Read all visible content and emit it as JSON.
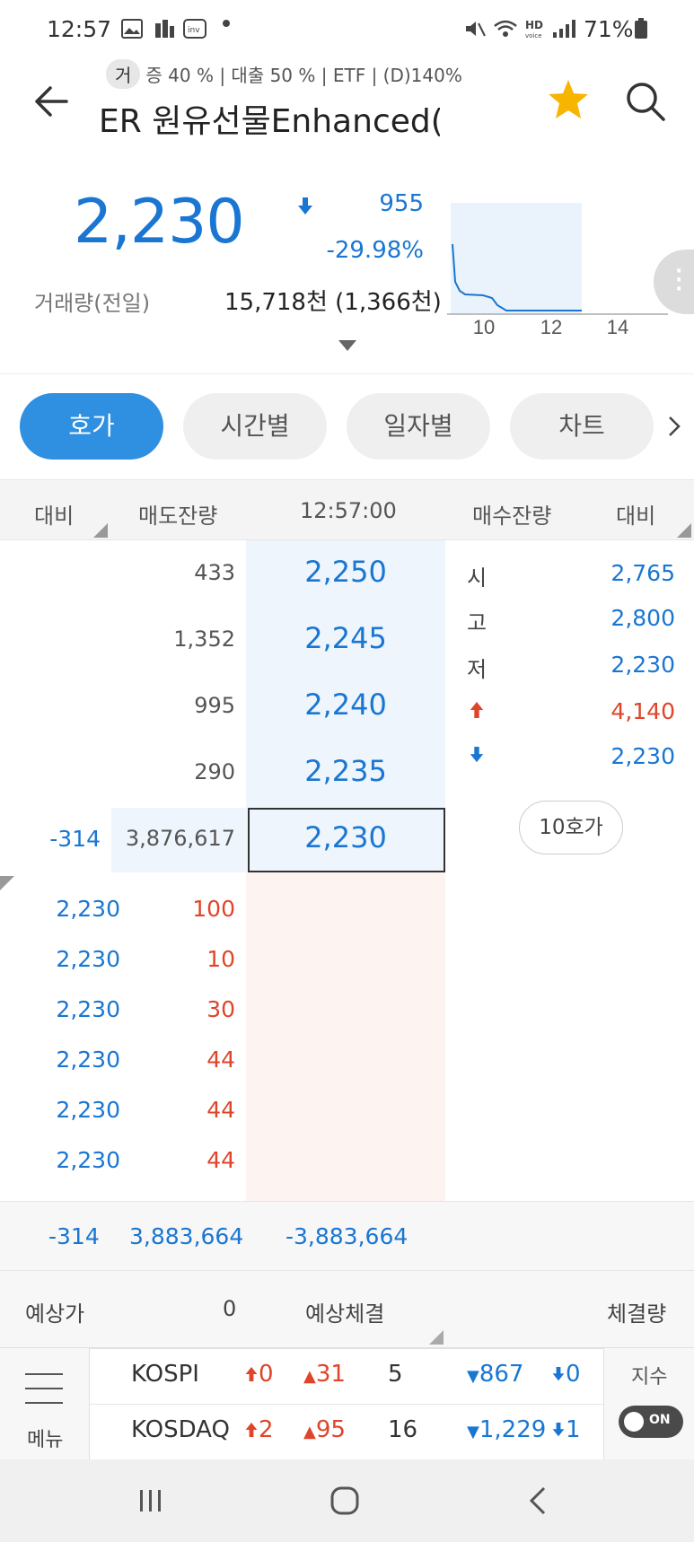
{
  "status_bar": {
    "time": "12:57",
    "battery": "71%"
  },
  "header": {
    "tag_chip": "거",
    "tagline": "증 40 % | 대출 50 % | ETF | (D)140%",
    "title": "ER 원유선물Enhanced("
  },
  "quote": {
    "price": "2,230",
    "change": "955",
    "change_pct": "-29.98%",
    "volume_label": "거래량(전일)",
    "volume_value": "15,718천 (1,366천)",
    "mini_chart_ticks": [
      "10",
      "12",
      "14"
    ]
  },
  "tabs": [
    "호가",
    "시간별",
    "일자별",
    "차트"
  ],
  "orderbook": {
    "headers": {
      "left_diff": "대비",
      "ask_qty": "매도잔량",
      "time": "12:57:00",
      "bid_qty": "매수잔량",
      "right_diff": "대비"
    },
    "asks": [
      {
        "qty": "433",
        "price": "2,250"
      },
      {
        "qty": "1,352",
        "price": "2,245"
      },
      {
        "qty": "995",
        "price": "2,240"
      },
      {
        "qty": "290",
        "price": "2,235"
      }
    ],
    "current": {
      "diff": "-314",
      "qty": "3,876,617",
      "price": "2,230"
    },
    "info": [
      {
        "label": "시",
        "value": "2,765"
      },
      {
        "label": "고",
        "value": "2,800"
      },
      {
        "label": "저",
        "value": "2,230"
      },
      {
        "label": "▲",
        "value": "4,140"
      },
      {
        "label": "▼",
        "value": "2,230"
      }
    ],
    "ten_quote_button": "10호가",
    "trades": [
      {
        "price": "2,230",
        "qty": "100"
      },
      {
        "price": "2,230",
        "qty": "10"
      },
      {
        "price": "2,230",
        "qty": "30"
      },
      {
        "price": "2,230",
        "qty": "44"
      },
      {
        "price": "2,230",
        "qty": "44"
      },
      {
        "price": "2,230",
        "qty": "44"
      }
    ]
  },
  "summary": {
    "diff": "-314",
    "ask_total": "3,883,664",
    "net": "-3,883,664"
  },
  "expected": {
    "label": "예상가",
    "value": "0",
    "match_label": "예상체결",
    "volume_label": "체결량"
  },
  "index_bar": {
    "menu_label": "메뉴",
    "toggle_label": "지수",
    "toggle_state": "ON",
    "rows": [
      {
        "name": "KOSPI",
        "up_limit": "0",
        "up": "31",
        "flat": "5",
        "down": "867",
        "down_limit": "0"
      },
      {
        "name": "KOSDAQ",
        "up_limit": "2",
        "up": "95",
        "flat": "16",
        "down": "1,229",
        "down_limit": "1"
      }
    ]
  },
  "colors": {
    "up": "#e0442a",
    "down": "#1976d2",
    "accent": "#2f8fe0",
    "star": "#f7b500"
  }
}
